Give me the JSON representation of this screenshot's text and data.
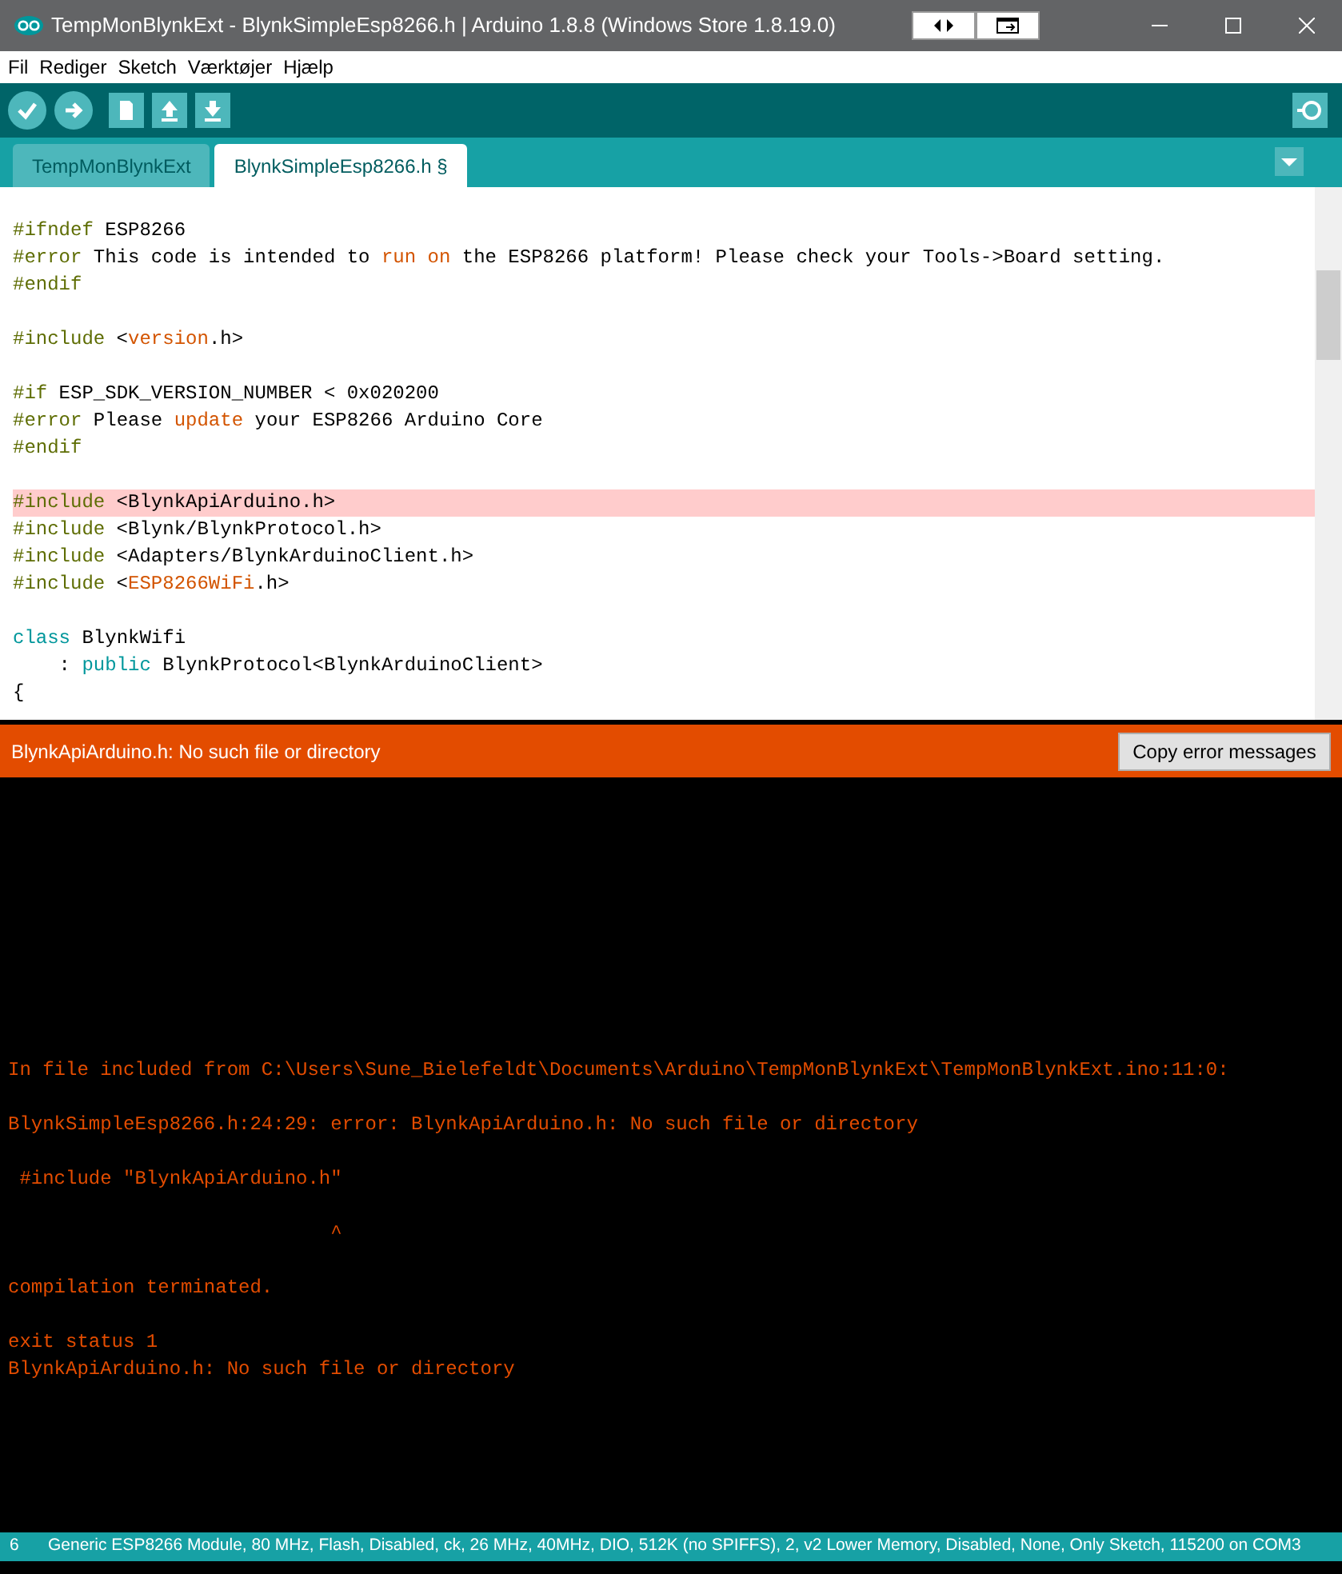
{
  "window": {
    "title": "TempMonBlynkExt - BlynkSimpleEsp8266.h | Arduino 1.8.8 (Windows Store 1.8.19.0)"
  },
  "menu": [
    "Fil",
    "Rediger",
    "Sketch",
    "Værktøjer",
    "Hjælp"
  ],
  "tabs": [
    {
      "label": "TempMonBlynkExt",
      "selected": false
    },
    {
      "label": "BlynkSimpleEsp8266.h §",
      "selected": true
    }
  ],
  "code_blocks": [
    [
      {
        "highlighted": false,
        "tokens": [
          {
            "text": "#ifndef",
            "kind": "directive"
          },
          {
            "text": " ESP8266",
            "kind": "plain"
          }
        ]
      },
      {
        "highlighted": false,
        "tokens": [
          {
            "text": "#error",
            "kind": "directive"
          },
          {
            "text": " This code is intended to ",
            "kind": "plain"
          },
          {
            "text": "run on",
            "kind": "keyword"
          },
          {
            "text": " the ESP8266 platform! Please check your Tools->Board setting.",
            "kind": "plain"
          }
        ]
      },
      {
        "highlighted": false,
        "tokens": [
          {
            "text": "#endif",
            "kind": "directive"
          }
        ]
      }
    ],
    [
      {
        "highlighted": false,
        "tokens": [
          {
            "text": "#include",
            "kind": "directive"
          },
          {
            "text": " <",
            "kind": "plain"
          },
          {
            "text": "version",
            "kind": "keyword"
          },
          {
            "text": ".h>",
            "kind": "plain"
          }
        ]
      }
    ],
    [
      {
        "highlighted": false,
        "tokens": [
          {
            "text": "#if",
            "kind": "directive"
          },
          {
            "text": " ESP_SDK_VERSION_NUMBER < 0x020200",
            "kind": "plain"
          }
        ]
      },
      {
        "highlighted": false,
        "tokens": [
          {
            "text": "#error",
            "kind": "directive"
          },
          {
            "text": " Please ",
            "kind": "plain"
          },
          {
            "text": "update",
            "kind": "keyword"
          },
          {
            "text": " your ESP8266 Arduino Core",
            "kind": "plain"
          }
        ]
      },
      {
        "highlighted": false,
        "tokens": [
          {
            "text": "#endif",
            "kind": "directive"
          }
        ]
      }
    ],
    [
      {
        "highlighted": true,
        "tokens": [
          {
            "text": "#include",
            "kind": "directive"
          },
          {
            "text": " <BlynkApiArduino.h>",
            "kind": "plain"
          }
        ]
      },
      {
        "highlighted": false,
        "tokens": [
          {
            "text": "#include",
            "kind": "directive"
          },
          {
            "text": " <Blynk/BlynkProtocol.h>",
            "kind": "plain"
          }
        ]
      },
      {
        "highlighted": false,
        "tokens": [
          {
            "text": "#include",
            "kind": "directive"
          },
          {
            "text": " <Adapters/BlynkArduinoClient.h>",
            "kind": "plain"
          }
        ]
      },
      {
        "highlighted": false,
        "tokens": [
          {
            "text": "#include",
            "kind": "directive"
          },
          {
            "text": " <",
            "kind": "plain"
          },
          {
            "text": "ESP8266WiFi",
            "kind": "keyword"
          },
          {
            "text": ".h>",
            "kind": "plain"
          }
        ]
      }
    ],
    [
      {
        "highlighted": false,
        "tokens": [
          {
            "text": "class",
            "kind": "type"
          },
          {
            "text": " BlynkWifi",
            "kind": "plain"
          }
        ]
      },
      {
        "highlighted": false,
        "tokens": [
          {
            "text": "    : ",
            "kind": "plain"
          },
          {
            "text": "public",
            "kind": "type"
          },
          {
            "text": " BlynkProtocol<BlynkArduinoClient>",
            "kind": "plain"
          }
        ]
      },
      {
        "highlighted": false,
        "tokens": [
          {
            "text": "{",
            "kind": "plain"
          }
        ]
      }
    ]
  ],
  "error_bar": {
    "message": "BlynkApiArduino.h: No such file or directory",
    "button": "Copy error messages"
  },
  "console_blocks": [
    [
      "In file included from C:\\Users\\Sune_Bielefeldt\\Documents\\Arduino\\TempMonBlynkExt\\TempMonBlynkExt.ino:11:0:"
    ],
    [
      "BlynkSimpleEsp8266.h:24:29: error: BlynkApiArduino.h: No such file or directory"
    ],
    [
      " #include \"BlynkApiArduino.h\""
    ],
    [
      "                            ^"
    ],
    [
      "compilation terminated."
    ],
    [
      "exit status 1",
      "BlynkApiArduino.h: No such file or directory"
    ]
  ],
  "status_bar": {
    "line": "6",
    "board": "Generic ESP8266 Module, 80 MHz, Flash, Disabled, ck, 26 MHz, 40MHz, DIO, 512K (no SPIFFS), 2, v2 Lower Memory, Disabled, None, Only Sketch, 115200 on COM3"
  }
}
